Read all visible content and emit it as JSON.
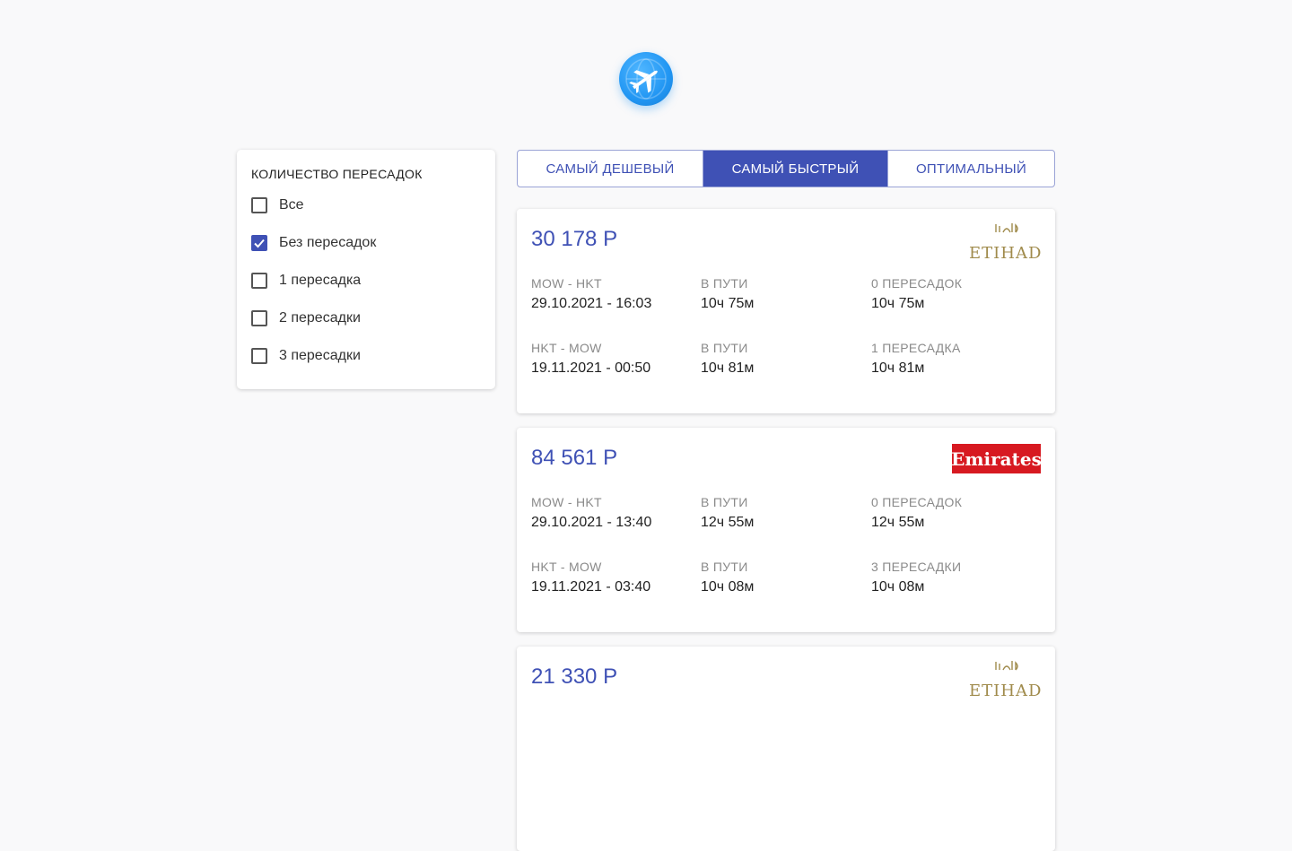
{
  "filter": {
    "title": "КОЛИЧЕСТВО ПЕРЕСАДОК",
    "options": [
      {
        "label": "Все",
        "checked": false
      },
      {
        "label": "Без пересадок",
        "checked": true
      },
      {
        "label": "1 пересадка",
        "checked": false
      },
      {
        "label": "2 пересадки",
        "checked": false
      },
      {
        "label": "3 пересадки",
        "checked": false
      }
    ]
  },
  "tabs": [
    {
      "label": "САМЫЙ ДЕШЕВЫЙ",
      "active": false
    },
    {
      "label": "САМЫЙ БЫСТРЫЙ",
      "active": true
    },
    {
      "label": "ОПТИМАЛЬНЫЙ",
      "active": false
    }
  ],
  "colors": {
    "accent": "#3f51b5",
    "logo_blue": "#2196f3",
    "emirates_red": "#d71921",
    "etihad_gold": "#a08b4c"
  },
  "tickets": [
    {
      "price": "30 178 Р",
      "carrier": "etihad",
      "carrier_text": "ETIHAD",
      "segments": [
        {
          "route": "MOW - HKT",
          "date": "29.10.2021 - 16:03",
          "duration_label": "В ПУТИ",
          "duration": "10ч 75м",
          "stops_label": "0 ПЕРЕСАДОК",
          "stops_value": "10ч 75м"
        },
        {
          "route": "HKT - MOW",
          "date": "19.11.2021 - 00:50",
          "duration_label": "В ПУТИ",
          "duration": "10ч 81м",
          "stops_label": "1 ПЕРЕСАДКА",
          "stops_value": "10ч 81м"
        }
      ]
    },
    {
      "price": "84 561 Р",
      "carrier": "emirates",
      "carrier_text": "Emirates",
      "segments": [
        {
          "route": "MOW - HKT",
          "date": "29.10.2021 - 13:40",
          "duration_label": "В ПУТИ",
          "duration": "12ч 55м",
          "stops_label": "0 ПЕРЕСАДОК",
          "stops_value": "12ч 55м"
        },
        {
          "route": "HKT - MOW",
          "date": "19.11.2021 - 03:40",
          "duration_label": "В ПУТИ",
          "duration": "10ч 08м",
          "stops_label": "3 ПЕРЕСАДКИ",
          "stops_value": "10ч 08м"
        }
      ]
    },
    {
      "price": "21 330 Р",
      "carrier": "etihad",
      "carrier_text": "ETIHAD",
      "segments": []
    }
  ]
}
